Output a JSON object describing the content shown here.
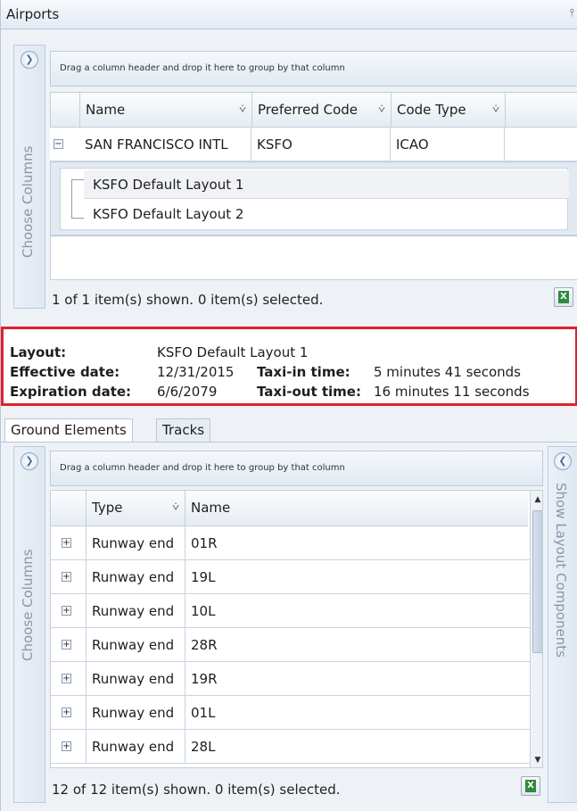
{
  "panel": {
    "title": "Airports",
    "pin_icon": "pin-icon"
  },
  "airports_grid": {
    "side_label": "Choose Columns",
    "group_hint": "Drag a column header and drop it here to group by that column",
    "columns": [
      "Name",
      "Preferred Code",
      "Code Type"
    ],
    "rows": [
      {
        "name": "SAN FRANCISCO INTL",
        "preferred_code": "KSFO",
        "code_type": "ICAO",
        "expanded": true
      }
    ],
    "layouts": [
      "KSFO Default Layout 1",
      "KSFO Default Layout 2"
    ],
    "status": "1 of 1 item(s) shown. 0 item(s) selected."
  },
  "layout_info": {
    "layout_label": "Layout:",
    "layout_value": "KSFO Default Layout 1",
    "effective_label": "Effective date:",
    "effective_value": "12/31/2015",
    "expiration_label": "Expiration date:",
    "expiration_value": "6/6/2079",
    "taxi_in_label": "Taxi-in time:",
    "taxi_in_value": "5 minutes 41 seconds",
    "taxi_out_label": "Taxi-out time:",
    "taxi_out_value": "16 minutes 11 seconds"
  },
  "tabs": [
    "Ground Elements",
    "Tracks"
  ],
  "elements_grid": {
    "side_label": "Choose Columns",
    "right_label": "Show Layout Components",
    "group_hint": "Drag a column header and drop it here to group by that column",
    "columns": [
      "Type",
      "Name"
    ],
    "rows": [
      {
        "type": "Runway end",
        "name": "01R"
      },
      {
        "type": "Runway end",
        "name": "19L"
      },
      {
        "type": "Runway end",
        "name": "10L"
      },
      {
        "type": "Runway end",
        "name": "28R"
      },
      {
        "type": "Runway end",
        "name": "19R"
      },
      {
        "type": "Runway end",
        "name": "01L"
      },
      {
        "type": "Runway end",
        "name": "28L"
      }
    ],
    "status": "12 of 12 item(s) shown. 0 item(s) selected."
  },
  "colors": {
    "highlight_border": "#e0202c",
    "accent": "#4a6e99"
  }
}
